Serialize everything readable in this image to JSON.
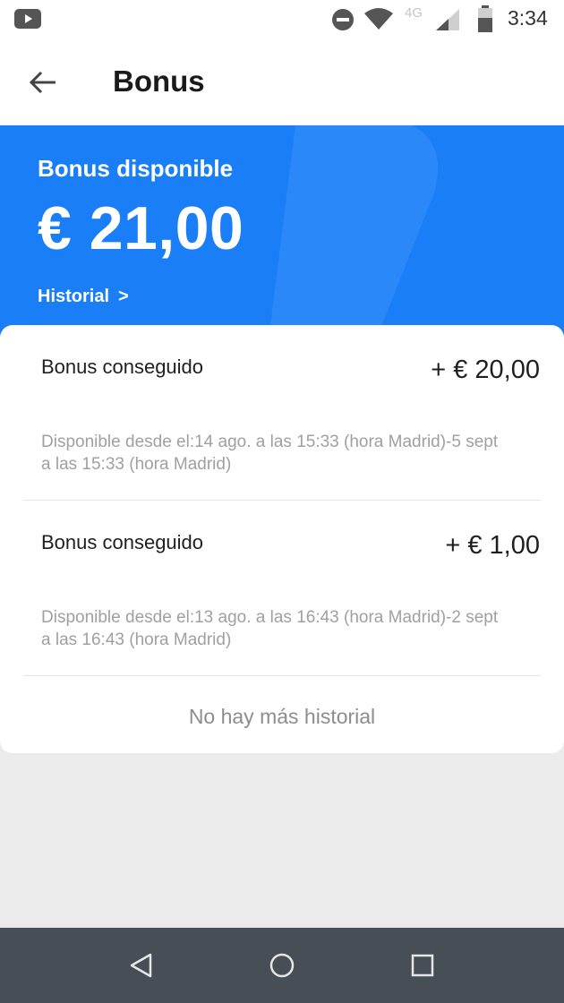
{
  "status_bar": {
    "time": "3:34",
    "network": "4G",
    "icons": [
      "youtube-icon",
      "do-not-disturb-icon",
      "wifi-icon",
      "signal-icon",
      "battery-icon"
    ]
  },
  "app_bar": {
    "title": "Bonus",
    "back_icon": "arrow-left-icon"
  },
  "hero": {
    "label": "Bonus disponible",
    "amount": "€ 21,00",
    "history_link": "Historial",
    "history_chevron": ">",
    "background_color": "#1a7ff7"
  },
  "entries": [
    {
      "title": "Bonus conseguido",
      "amount": "+ € 20,00",
      "desc_line1": "Disponible desde el:14 ago. a las 15:33 (hora Madrid)-5 sept",
      "desc_line2": "a las 15:33 (hora Madrid)"
    },
    {
      "title": "Bonus conseguido",
      "amount": "+ € 1,00",
      "desc_line1": "Disponible desde el:13 ago. a las 16:43 (hora Madrid)-2 sept",
      "desc_line2": "a las 16:43 (hora Madrid)"
    }
  ],
  "footer_note": "No hay más historial",
  "nav_bar": {
    "buttons": [
      "back-triangle-icon",
      "home-circle-icon",
      "recents-square-icon"
    ]
  }
}
